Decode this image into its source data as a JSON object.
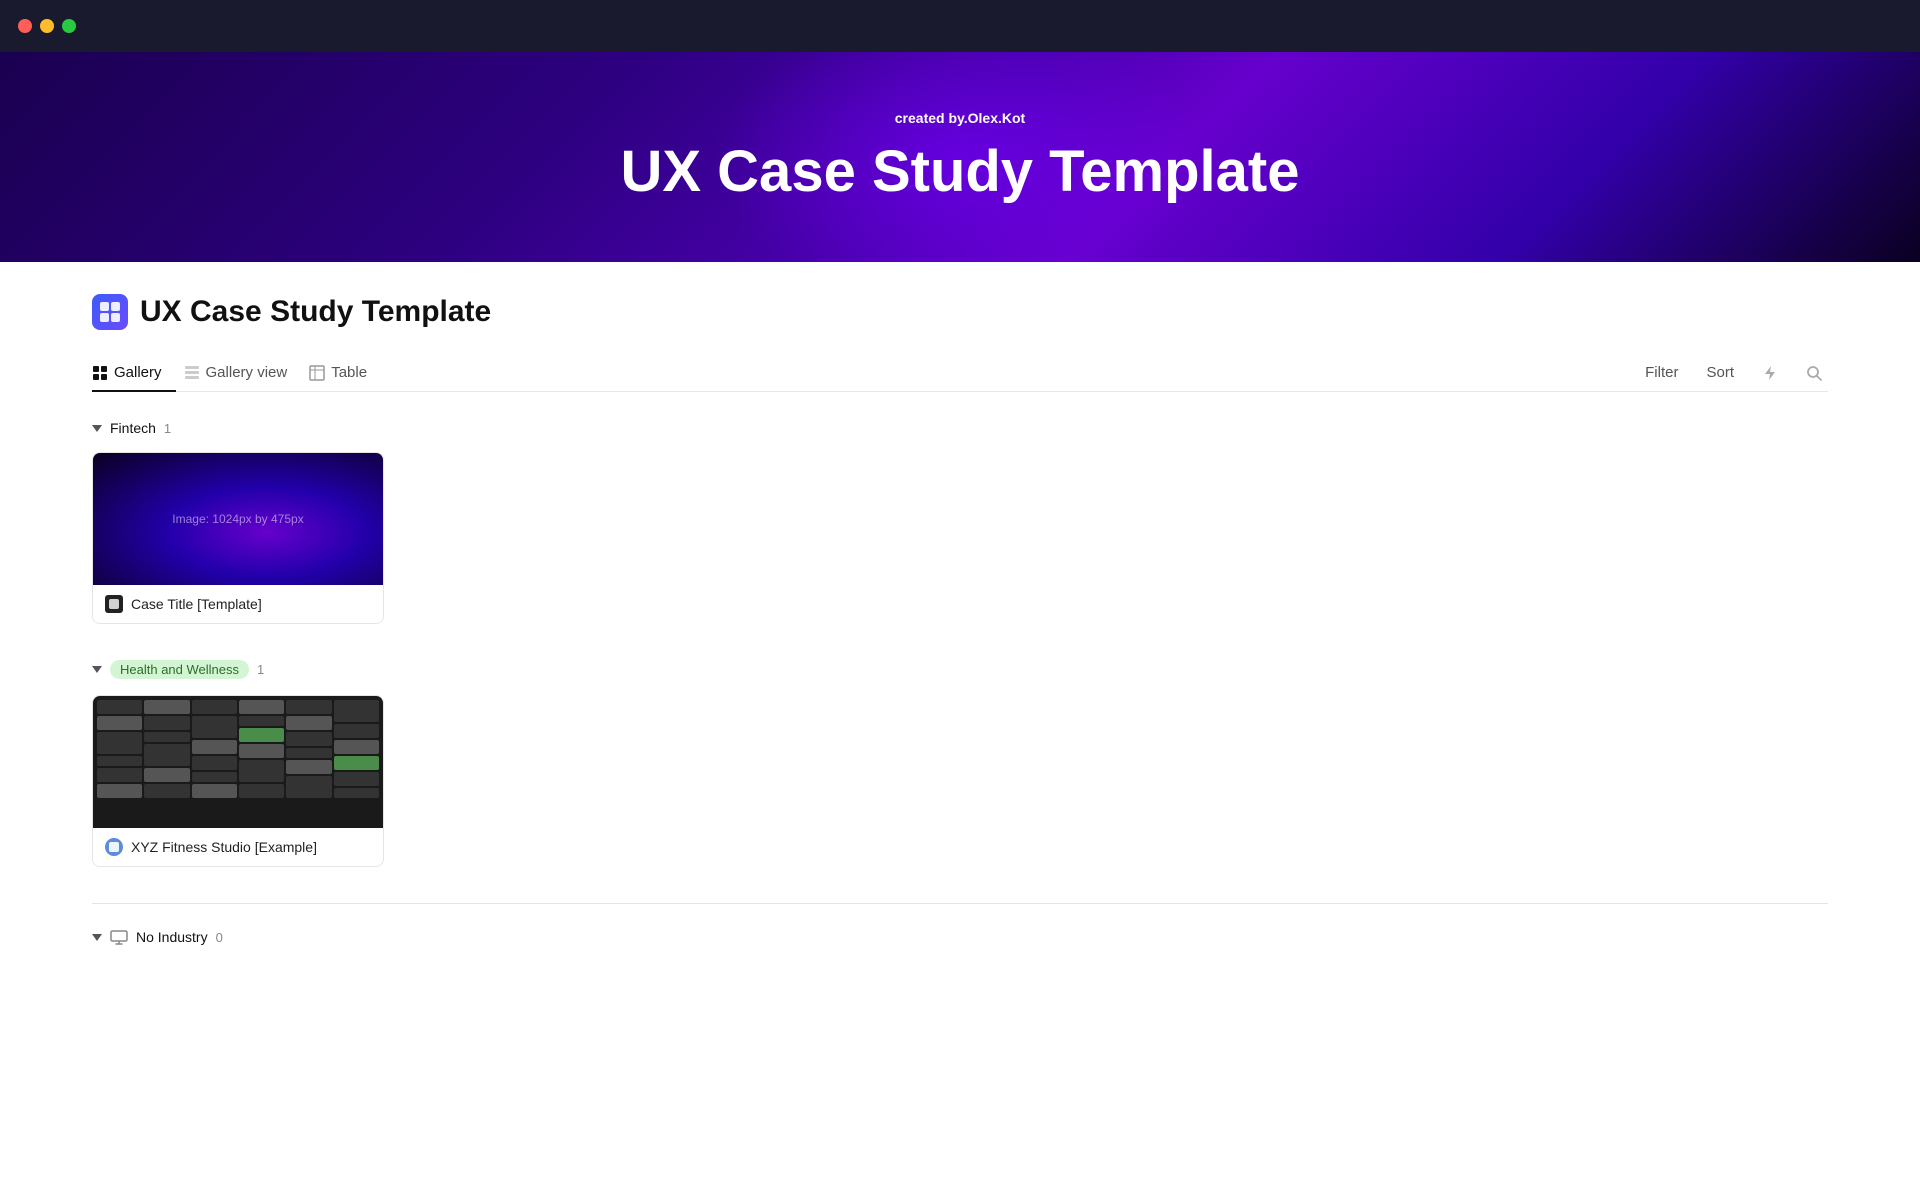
{
  "titlebar": {
    "traffic_lights": [
      "red",
      "yellow",
      "green"
    ]
  },
  "hero": {
    "credit_prefix": "created by.",
    "credit_author": "Olex.Kot",
    "title": "UX Case Study Template"
  },
  "page": {
    "icon_label": "grid-icon",
    "title": "UX Case Study Template"
  },
  "tabs": [
    {
      "id": "gallery",
      "label": "Gallery",
      "icon": "grid-icon",
      "active": true
    },
    {
      "id": "gallery-view",
      "label": "Gallery view",
      "icon": "table-icon",
      "active": false
    },
    {
      "id": "table",
      "label": "Table",
      "icon": "table-icon",
      "active": false
    }
  ],
  "toolbar": {
    "filter_label": "Filter",
    "sort_label": "Sort",
    "lightning_icon": "⚡",
    "search_icon": "🔍"
  },
  "groups": [
    {
      "id": "fintech",
      "label": "Fintech",
      "count": 1,
      "tag_style": "plain",
      "cards": [
        {
          "id": "case-template",
          "thumb_type": "fintech",
          "thumb_label": "Image: 1024px by 475px",
          "title": "Case Title [Template]",
          "icon_type": "dark"
        }
      ]
    },
    {
      "id": "health-wellness",
      "label": "Health and Wellness",
      "count": 1,
      "tag_style": "green",
      "cards": [
        {
          "id": "xyz-fitness",
          "thumb_type": "fitness",
          "title": "XYZ Fitness Studio [Example]",
          "icon_type": "blue"
        }
      ]
    },
    {
      "id": "no-industry",
      "label": "No Industry",
      "count": 0,
      "tag_style": "plain",
      "cards": []
    }
  ]
}
